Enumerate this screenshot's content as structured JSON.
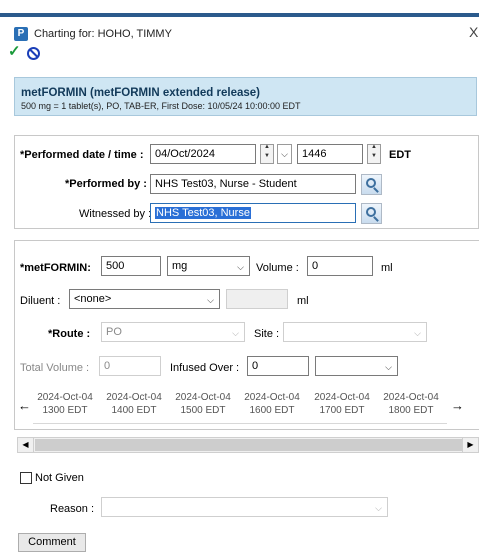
{
  "window": {
    "app_logo": "P",
    "title": "Charting for: HOHO, TIMMY",
    "close": "X"
  },
  "toolbar": {
    "sign_icon": "checkmark-icon",
    "cancel_icon": "cancel-icon"
  },
  "order": {
    "name": "metFORMIN (metFORMIN extended release)",
    "details": "500 mg = 1 tablet(s), PO, TAB-ER, First Dose: 10/05/24 10:00:00 EDT"
  },
  "performed": {
    "date_label": "*Performed date / time :",
    "date_value": "04/Oct/2024",
    "time_value": "1446",
    "timezone": "EDT",
    "by_label": "*Performed by :",
    "by_value": "NHS Test03, Nurse - Student",
    "witnessed_label": "Witnessed by :",
    "witnessed_value": "NHS Test03, Nurse"
  },
  "dose": {
    "drug_label": "*metFORMIN:",
    "dose_value": "500",
    "unit_value": "mg",
    "volume_label": "Volume :",
    "volume_value": "0",
    "volume_unit": "ml",
    "diluent_label": "Diluent :",
    "diluent_value": "<none>",
    "diluent_unit": "ml",
    "route_label": "*Route :",
    "route_value": "PO",
    "site_label": "Site :",
    "total_volume_label": "Total Volume :",
    "total_volume_value": "0",
    "infused_over_label": "Infused Over :",
    "infused_over_value": "0"
  },
  "timeline": {
    "left_arrow": "←",
    "right_arrow": "→",
    "columns": [
      {
        "date": "2024-Oct-04",
        "time": "1300 EDT"
      },
      {
        "date": "2024-Oct-04",
        "time": "1400 EDT"
      },
      {
        "date": "2024-Oct-04",
        "time": "1500 EDT"
      },
      {
        "date": "2024-Oct-04",
        "time": "1600 EDT"
      },
      {
        "date": "2024-Oct-04",
        "time": "1700 EDT"
      },
      {
        "date": "2024-Oct-04",
        "time": "1800 EDT"
      }
    ]
  },
  "not_given": {
    "label": "Not Given",
    "checked": false,
    "reason_label": "Reason :"
  },
  "footer": {
    "comment_label": "Comment"
  }
}
